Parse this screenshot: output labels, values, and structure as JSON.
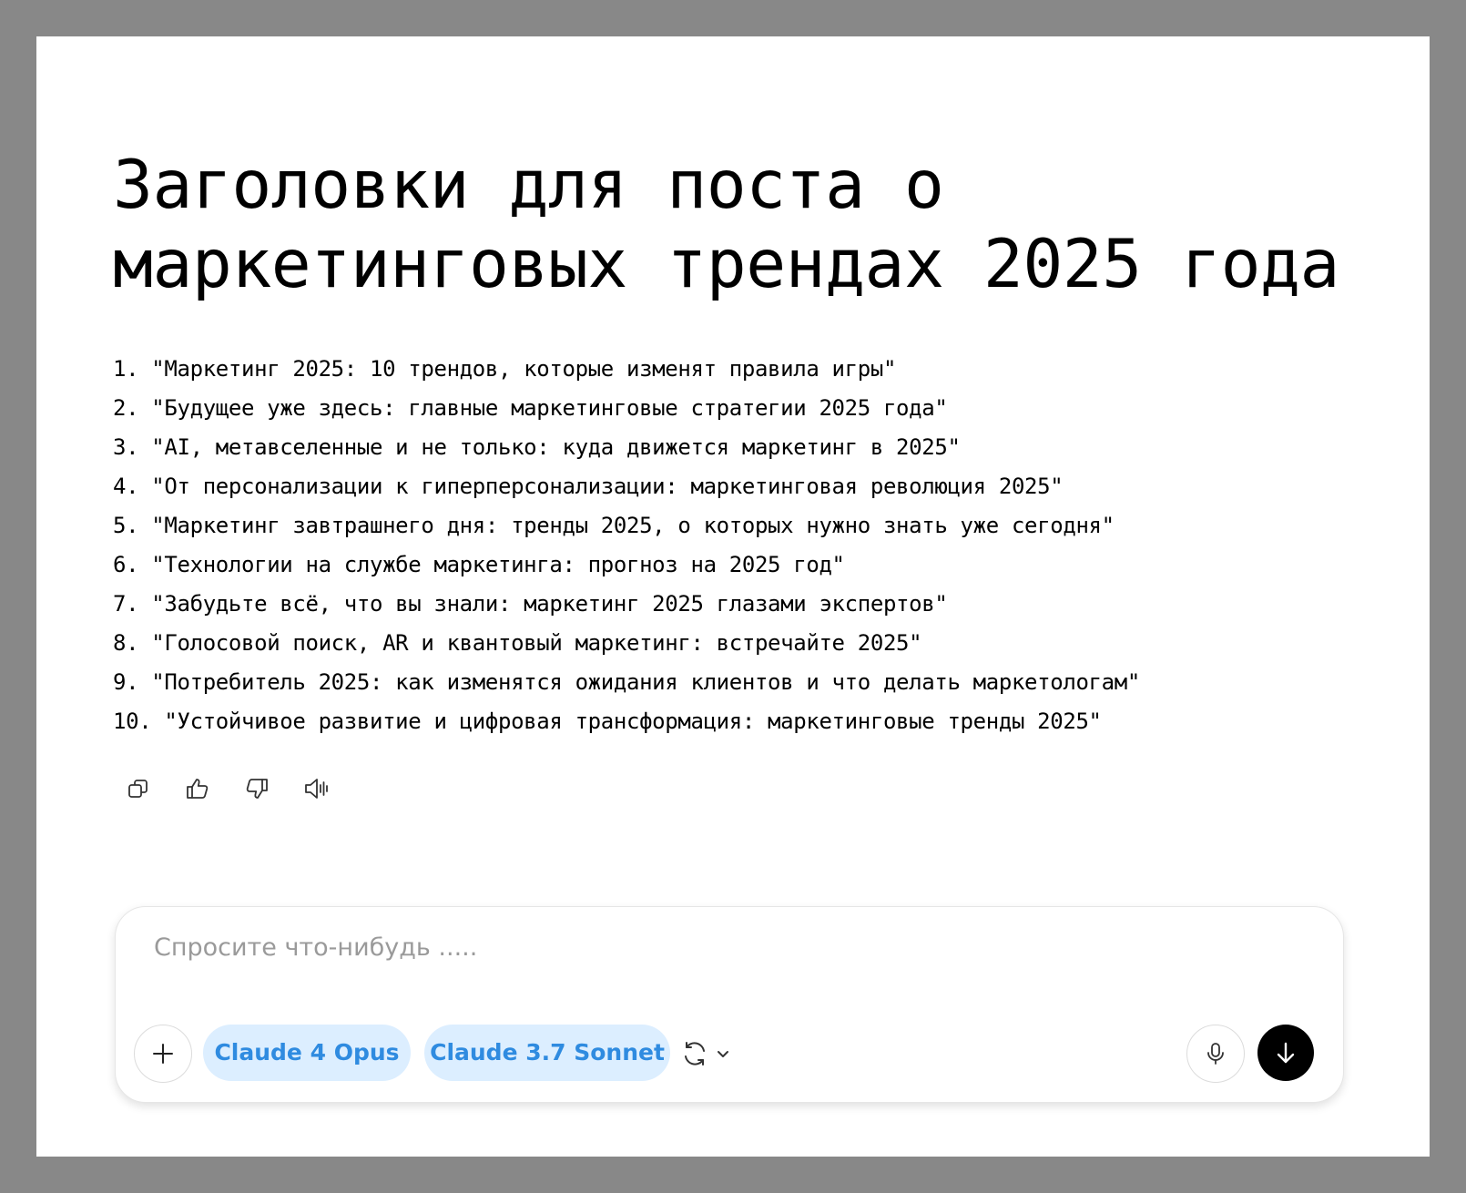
{
  "title": "Заголовки для поста о маркетинговых трендах 2025 года",
  "headlines": [
    "1. \"Маркетинг 2025: 10 трендов, которые изменят правила игры\"",
    "2. \"Будущее уже здесь: главные маркетинговые стратегии 2025 года\"",
    "3. \"AI, метавселенные и не только: куда движется маркетинг в 2025\"",
    "4. \"От персонализации к гиперперсонализации: маркетинговая революция 2025\"",
    "5. \"Маркетинг завтрашнего дня: тренды 2025, о которых нужно знать уже сегодня\"",
    "6. \"Технологии на службе маркетинга: прогноз на 2025 год\"",
    "7. \"Забудьте всё, что вы знали: маркетинг 2025 глазами экспертов\"",
    "8. \"Голосовой поиск, AR и квантовый маркетинг: встречайте 2025\"",
    "9. \"Потребитель 2025: как изменятся ожидания клиентов и что делать маркетологам\"",
    "10. \"Устойчивое развитие и цифровая трансформация: маркетинговые тренды 2025\""
  ],
  "actions": {
    "icons": [
      "copy-icon",
      "thumbs-up-icon",
      "thumbs-down-icon",
      "speaker-icon"
    ]
  },
  "composer": {
    "placeholder": "Спросите что-нибудь .....",
    "value": "",
    "models": [
      "Claude 4 Opus",
      "Claude 3.7 Sonnet"
    ],
    "icons": {
      "add": "plus-icon",
      "switch": "refresh-icon",
      "dropdown": "chevron-down-icon",
      "voice": "microphone-icon",
      "send": "arrow-down-icon"
    }
  },
  "colors": {
    "background": "#888888",
    "page": "#ffffff",
    "chip_bg": "#dceeff",
    "chip_text": "#2f8be0",
    "send_bg": "#000000"
  }
}
